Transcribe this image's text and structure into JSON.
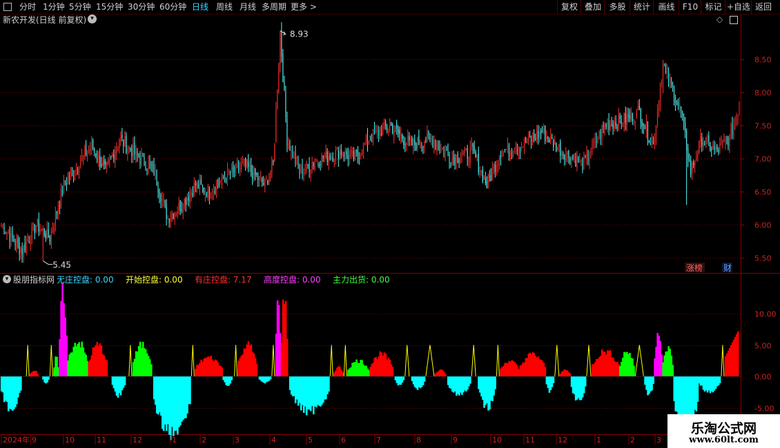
{
  "toolbar": {
    "periods": [
      {
        "label": "分时",
        "active": false
      },
      {
        "label": "1分钟",
        "active": false
      },
      {
        "label": "5分钟",
        "active": false
      },
      {
        "label": "15分钟",
        "active": false
      },
      {
        "label": "30分钟",
        "active": false
      },
      {
        "label": "60分钟",
        "active": false
      },
      {
        "label": "日线",
        "active": true
      },
      {
        "label": "周线",
        "active": false
      },
      {
        "label": "月线",
        "active": false
      },
      {
        "label": "多周期",
        "active": false
      },
      {
        "label": "更多 >",
        "active": false
      }
    ],
    "right_buttons": [
      "复权",
      "叠加",
      "多股",
      "统计",
      "画线",
      "F10",
      "标记",
      "+自选",
      "返回"
    ]
  },
  "main_panel": {
    "title": "新农开发(日线 前复权)",
    "high_marker": "8.93",
    "low_marker": "5.45",
    "badges": {
      "zhangting": "涨榜",
      "cai": "财"
    },
    "y_ticks": [
      "8.50",
      "8.00",
      "7.50",
      "7.00",
      "6.50",
      "6.00",
      "5.50"
    ]
  },
  "indicator_panel": {
    "name": "股朋指标网",
    "values": [
      {
        "label": "无庄控盘:",
        "value": "0.00",
        "color": "#3ad6ff"
      },
      {
        "label": "开始控盘:",
        "value": "0.00",
        "color": "#ffff3a"
      },
      {
        "label": "有庄控盘:",
        "value": "7.17",
        "color": "#ff3030"
      },
      {
        "label": "高度控盘:",
        "value": "0.00",
        "color": "#ff40ff"
      },
      {
        "label": "主力出货:",
        "value": "0.00",
        "color": "#40ff40"
      }
    ],
    "y_ticks": [
      "10.00",
      "5.00",
      "0.00",
      "-5.00"
    ]
  },
  "time_axis": [
    "2024年",
    "9",
    "10",
    "11",
    "12",
    "1",
    "2",
    "3",
    "4",
    "5",
    "6",
    "7",
    "8",
    "9",
    "10",
    "11",
    "12",
    "1",
    "2",
    "3"
  ],
  "watermark": {
    "line1": "乐淘公式网",
    "line2": "www.60lt.com"
  },
  "colors": {
    "up": "#ff3030",
    "down": "#54ffff",
    "grid": "#8b0000",
    "noctrl": "#00ffff",
    "start": "#ffff00",
    "ctrl": "#ff0000",
    "high": "#ff00ff",
    "out": "#00ff00"
  },
  "chart_data": {
    "type": "candlestick+histogram",
    "price_range": [
      5.45,
      8.93
    ],
    "price_ylim": [
      5.3,
      9.0
    ],
    "price_anchors": [
      {
        "i": 0,
        "v": 6.0
      },
      {
        "i": 15,
        "v": 5.6
      },
      {
        "i": 25,
        "v": 6.0
      },
      {
        "i": 35,
        "v": 5.8
      },
      {
        "i": 45,
        "v": 6.6
      },
      {
        "i": 55,
        "v": 6.9
      },
      {
        "i": 65,
        "v": 7.2
      },
      {
        "i": 75,
        "v": 6.8
      },
      {
        "i": 85,
        "v": 7.3
      },
      {
        "i": 95,
        "v": 7.1
      },
      {
        "i": 110,
        "v": 6.8
      },
      {
        "i": 120,
        "v": 6.1
      },
      {
        "i": 130,
        "v": 6.3
      },
      {
        "i": 140,
        "v": 6.6
      },
      {
        "i": 150,
        "v": 6.5
      },
      {
        "i": 160,
        "v": 6.7
      },
      {
        "i": 175,
        "v": 6.9
      },
      {
        "i": 190,
        "v": 6.6
      },
      {
        "i": 196,
        "v": 6.9
      },
      {
        "i": 201,
        "v": 8.9
      },
      {
        "i": 206,
        "v": 7.3
      },
      {
        "i": 215,
        "v": 6.8
      },
      {
        "i": 230,
        "v": 7.0
      },
      {
        "i": 245,
        "v": 7.1
      },
      {
        "i": 255,
        "v": 7.0
      },
      {
        "i": 265,
        "v": 7.3
      },
      {
        "i": 280,
        "v": 7.5
      },
      {
        "i": 295,
        "v": 7.2
      },
      {
        "i": 310,
        "v": 7.3
      },
      {
        "i": 325,
        "v": 7.0
      },
      {
        "i": 340,
        "v": 7.1
      },
      {
        "i": 350,
        "v": 6.6
      },
      {
        "i": 360,
        "v": 7.1
      },
      {
        "i": 375,
        "v": 7.2
      },
      {
        "i": 390,
        "v": 7.4
      },
      {
        "i": 405,
        "v": 7.1
      },
      {
        "i": 420,
        "v": 6.9
      },
      {
        "i": 435,
        "v": 7.5
      },
      {
        "i": 450,
        "v": 7.6
      },
      {
        "i": 460,
        "v": 7.7
      },
      {
        "i": 470,
        "v": 7.2
      },
      {
        "i": 477,
        "v": 8.4
      },
      {
        "i": 490,
        "v": 7.7
      },
      {
        "i": 497,
        "v": 6.8
      },
      {
        "i": 505,
        "v": 7.3
      },
      {
        "i": 515,
        "v": 7.1
      },
      {
        "i": 525,
        "v": 7.3
      },
      {
        "i": 532,
        "v": 7.8
      }
    ],
    "spikes": [
      {
        "i": 201,
        "high": 8.93
      },
      {
        "i": 30,
        "low": 5.45
      },
      {
        "i": 494,
        "low": 6.3
      }
    ],
    "indicator_ylim": [
      -9,
      14.5
    ],
    "indicator_segments": [
      {
        "from": 0,
        "to": 14,
        "type": "noctrl",
        "peak": -5.2
      },
      {
        "from": 18,
        "to": 20,
        "type": "start",
        "peak": 5.0
      },
      {
        "from": 21,
        "to": 26,
        "type": "ctrl",
        "peak": 1.0
      },
      {
        "from": 30,
        "to": 34,
        "type": "noctrl",
        "peak": -1.2
      },
      {
        "from": 35,
        "to": 37,
        "type": "start",
        "peak": 5.0
      },
      {
        "from": 38,
        "to": 41,
        "type": "out",
        "peak": 3.0
      },
      {
        "from": 42,
        "to": 47,
        "type": "high",
        "peak": 13.5
      },
      {
        "from": 48,
        "to": 62,
        "type": "out",
        "peak": 5.5
      },
      {
        "from": 63,
        "to": 76,
        "type": "ctrl",
        "peak": 5.0
      },
      {
        "from": 80,
        "to": 89,
        "type": "noctrl",
        "peak": -3.0
      },
      {
        "from": 92,
        "to": 94,
        "type": "start",
        "peak": 5.0
      },
      {
        "from": 95,
        "to": 108,
        "type": "out",
        "peak": 5.0
      },
      {
        "from": 110,
        "to": 136,
        "type": "noctrl",
        "peak": -9.0
      },
      {
        "from": 137,
        "to": 139,
        "type": "start",
        "peak": 5.0
      },
      {
        "from": 140,
        "to": 159,
        "type": "ctrl",
        "peak": 3.0
      },
      {
        "from": 160,
        "to": 166,
        "type": "noctrl",
        "peak": -1.5
      },
      {
        "from": 168,
        "to": 170,
        "type": "start",
        "peak": 5.0
      },
      {
        "from": 171,
        "to": 184,
        "type": "ctrl",
        "peak": 5.0
      },
      {
        "from": 186,
        "to": 194,
        "type": "noctrl",
        "peak": -1.0
      },
      {
        "from": 195,
        "to": 197,
        "type": "start",
        "peak": 5.0
      },
      {
        "from": 198,
        "to": 201,
        "type": "high",
        "peak": 14.0
      },
      {
        "from": 202,
        "to": 206,
        "type": "ctrl",
        "peak": 13.0
      },
      {
        "from": 208,
        "to": 236,
        "type": "noctrl",
        "peak": -5.5
      },
      {
        "from": 237,
        "to": 239,
        "type": "start",
        "peak": 5.0
      },
      {
        "from": 240,
        "to": 246,
        "type": "ctrl",
        "peak": 1.5
      },
      {
        "from": 247,
        "to": 249,
        "type": "start",
        "peak": 5.0
      },
      {
        "from": 250,
        "to": 265,
        "type": "out",
        "peak": 2.5
      },
      {
        "from": 266,
        "to": 282,
        "type": "ctrl",
        "peak": 3.5
      },
      {
        "from": 284,
        "to": 290,
        "type": "noctrl",
        "peak": -1.5
      },
      {
        "from": 291,
        "to": 294,
        "type": "start",
        "peak": 5.0
      },
      {
        "from": 296,
        "to": 305,
        "type": "noctrl",
        "peak": -2.0
      },
      {
        "from": 306,
        "to": 312,
        "type": "start",
        "peak": 5.0
      },
      {
        "from": 313,
        "to": 320,
        "type": "ctrl",
        "peak": 1.0
      },
      {
        "from": 322,
        "to": 338,
        "type": "noctrl",
        "peak": -3.0
      },
      {
        "from": 339,
        "to": 342,
        "type": "start",
        "peak": 5.0
      },
      {
        "from": 344,
        "to": 356,
        "type": "noctrl",
        "peak": -5.0
      },
      {
        "from": 357,
        "to": 359,
        "type": "start",
        "peak": 5.0
      },
      {
        "from": 360,
        "to": 373,
        "type": "ctrl",
        "peak": 2.5
      },
      {
        "from": 374,
        "to": 392,
        "type": "ctrl",
        "peak": 3.5
      },
      {
        "from": 393,
        "to": 398,
        "type": "noctrl",
        "peak": -2.5
      },
      {
        "from": 399,
        "to": 402,
        "type": "start",
        "peak": 5.0
      },
      {
        "from": 403,
        "to": 410,
        "type": "ctrl",
        "peak": 1.0
      },
      {
        "from": 411,
        "to": 421,
        "type": "noctrl",
        "peak": -4.0
      },
      {
        "from": 422,
        "to": 425,
        "type": "start",
        "peak": 5.0
      },
      {
        "from": 426,
        "to": 445,
        "type": "ctrl",
        "peak": 4.0
      },
      {
        "from": 446,
        "to": 456,
        "type": "out",
        "peak": 4.0
      },
      {
        "from": 457,
        "to": 463,
        "type": "start",
        "peak": 5.0
      },
      {
        "from": 464,
        "to": 470,
        "type": "noctrl",
        "peak": -3.0
      },
      {
        "from": 471,
        "to": 476,
        "type": "high",
        "peak": 7.0
      },
      {
        "from": 477,
        "to": 484,
        "type": "out",
        "peak": 4.5
      },
      {
        "from": 485,
        "to": 502,
        "type": "noctrl",
        "peak": -9.0
      },
      {
        "from": 503,
        "to": 518,
        "type": "noctrl",
        "peak": -2.5
      },
      {
        "from": 519,
        "to": 521,
        "type": "start",
        "peak": 5.0
      },
      {
        "from": 522,
        "to": 531,
        "type": "ctrl",
        "peak": 7.17
      }
    ]
  }
}
